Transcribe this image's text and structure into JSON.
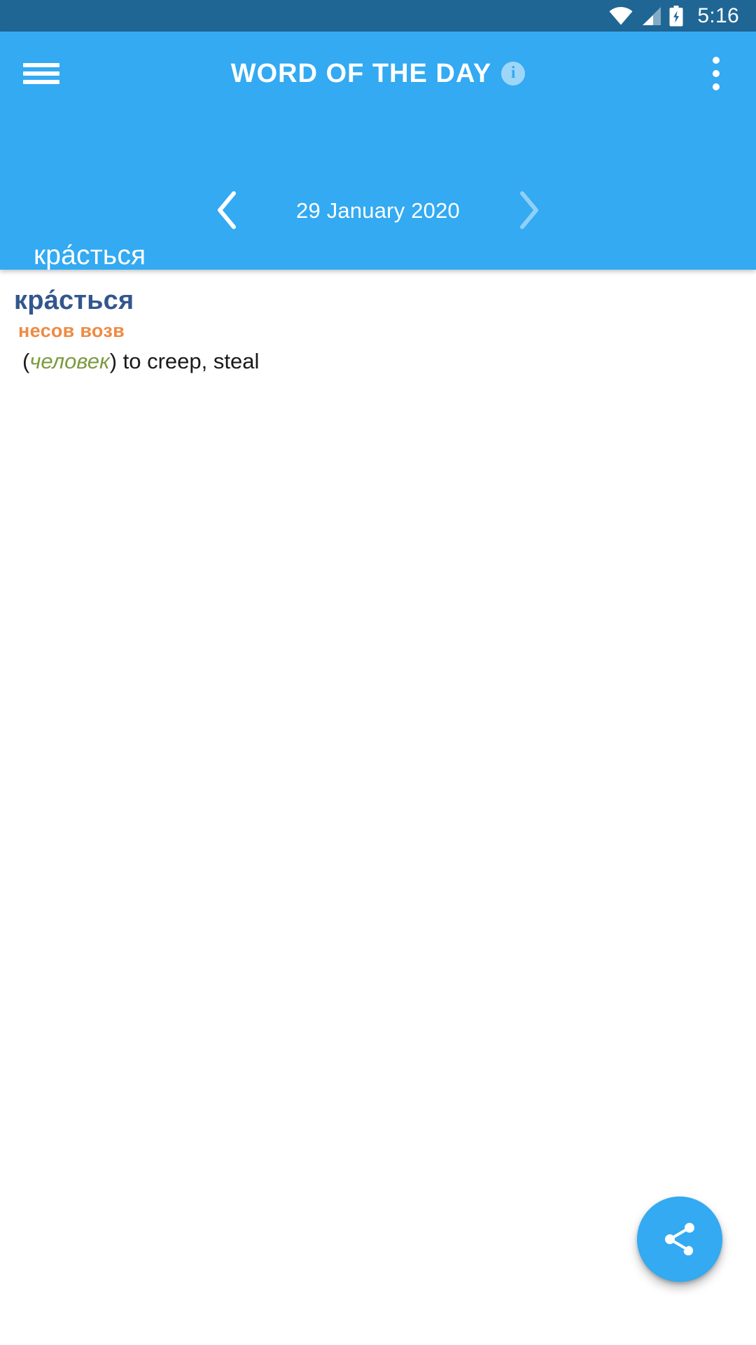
{
  "status_bar": {
    "time": "5:16",
    "icons": [
      "wifi-icon",
      "cellular-signal-icon",
      "battery-charging-icon"
    ],
    "background_color": "#1F6695"
  },
  "app_bar": {
    "menu_icon": "hamburger-menu-icon",
    "title": "WORD OF THE DAY",
    "info_icon_label": "i",
    "overflow_icon": "overflow-menu-icon",
    "background_color": "#33AAF2"
  },
  "date_nav": {
    "prev_label": "‹",
    "date": "29 January 2020",
    "next_label": "›",
    "next_disabled": true
  },
  "header_word": {
    "text": "кра́сться"
  },
  "entry": {
    "headword": "кра́сться",
    "headword_color": "#33568E",
    "part_of_speech": "несов возв",
    "part_of_speech_color": "#EF8A44",
    "senses": [
      {
        "open_paren": "(",
        "label": "человек",
        "label_color": "#7D9A40",
        "close_paren": ")",
        "gloss": " to creep, steal"
      }
    ]
  },
  "fab": {
    "icon": "share-icon",
    "background_color": "#33AAF2"
  }
}
